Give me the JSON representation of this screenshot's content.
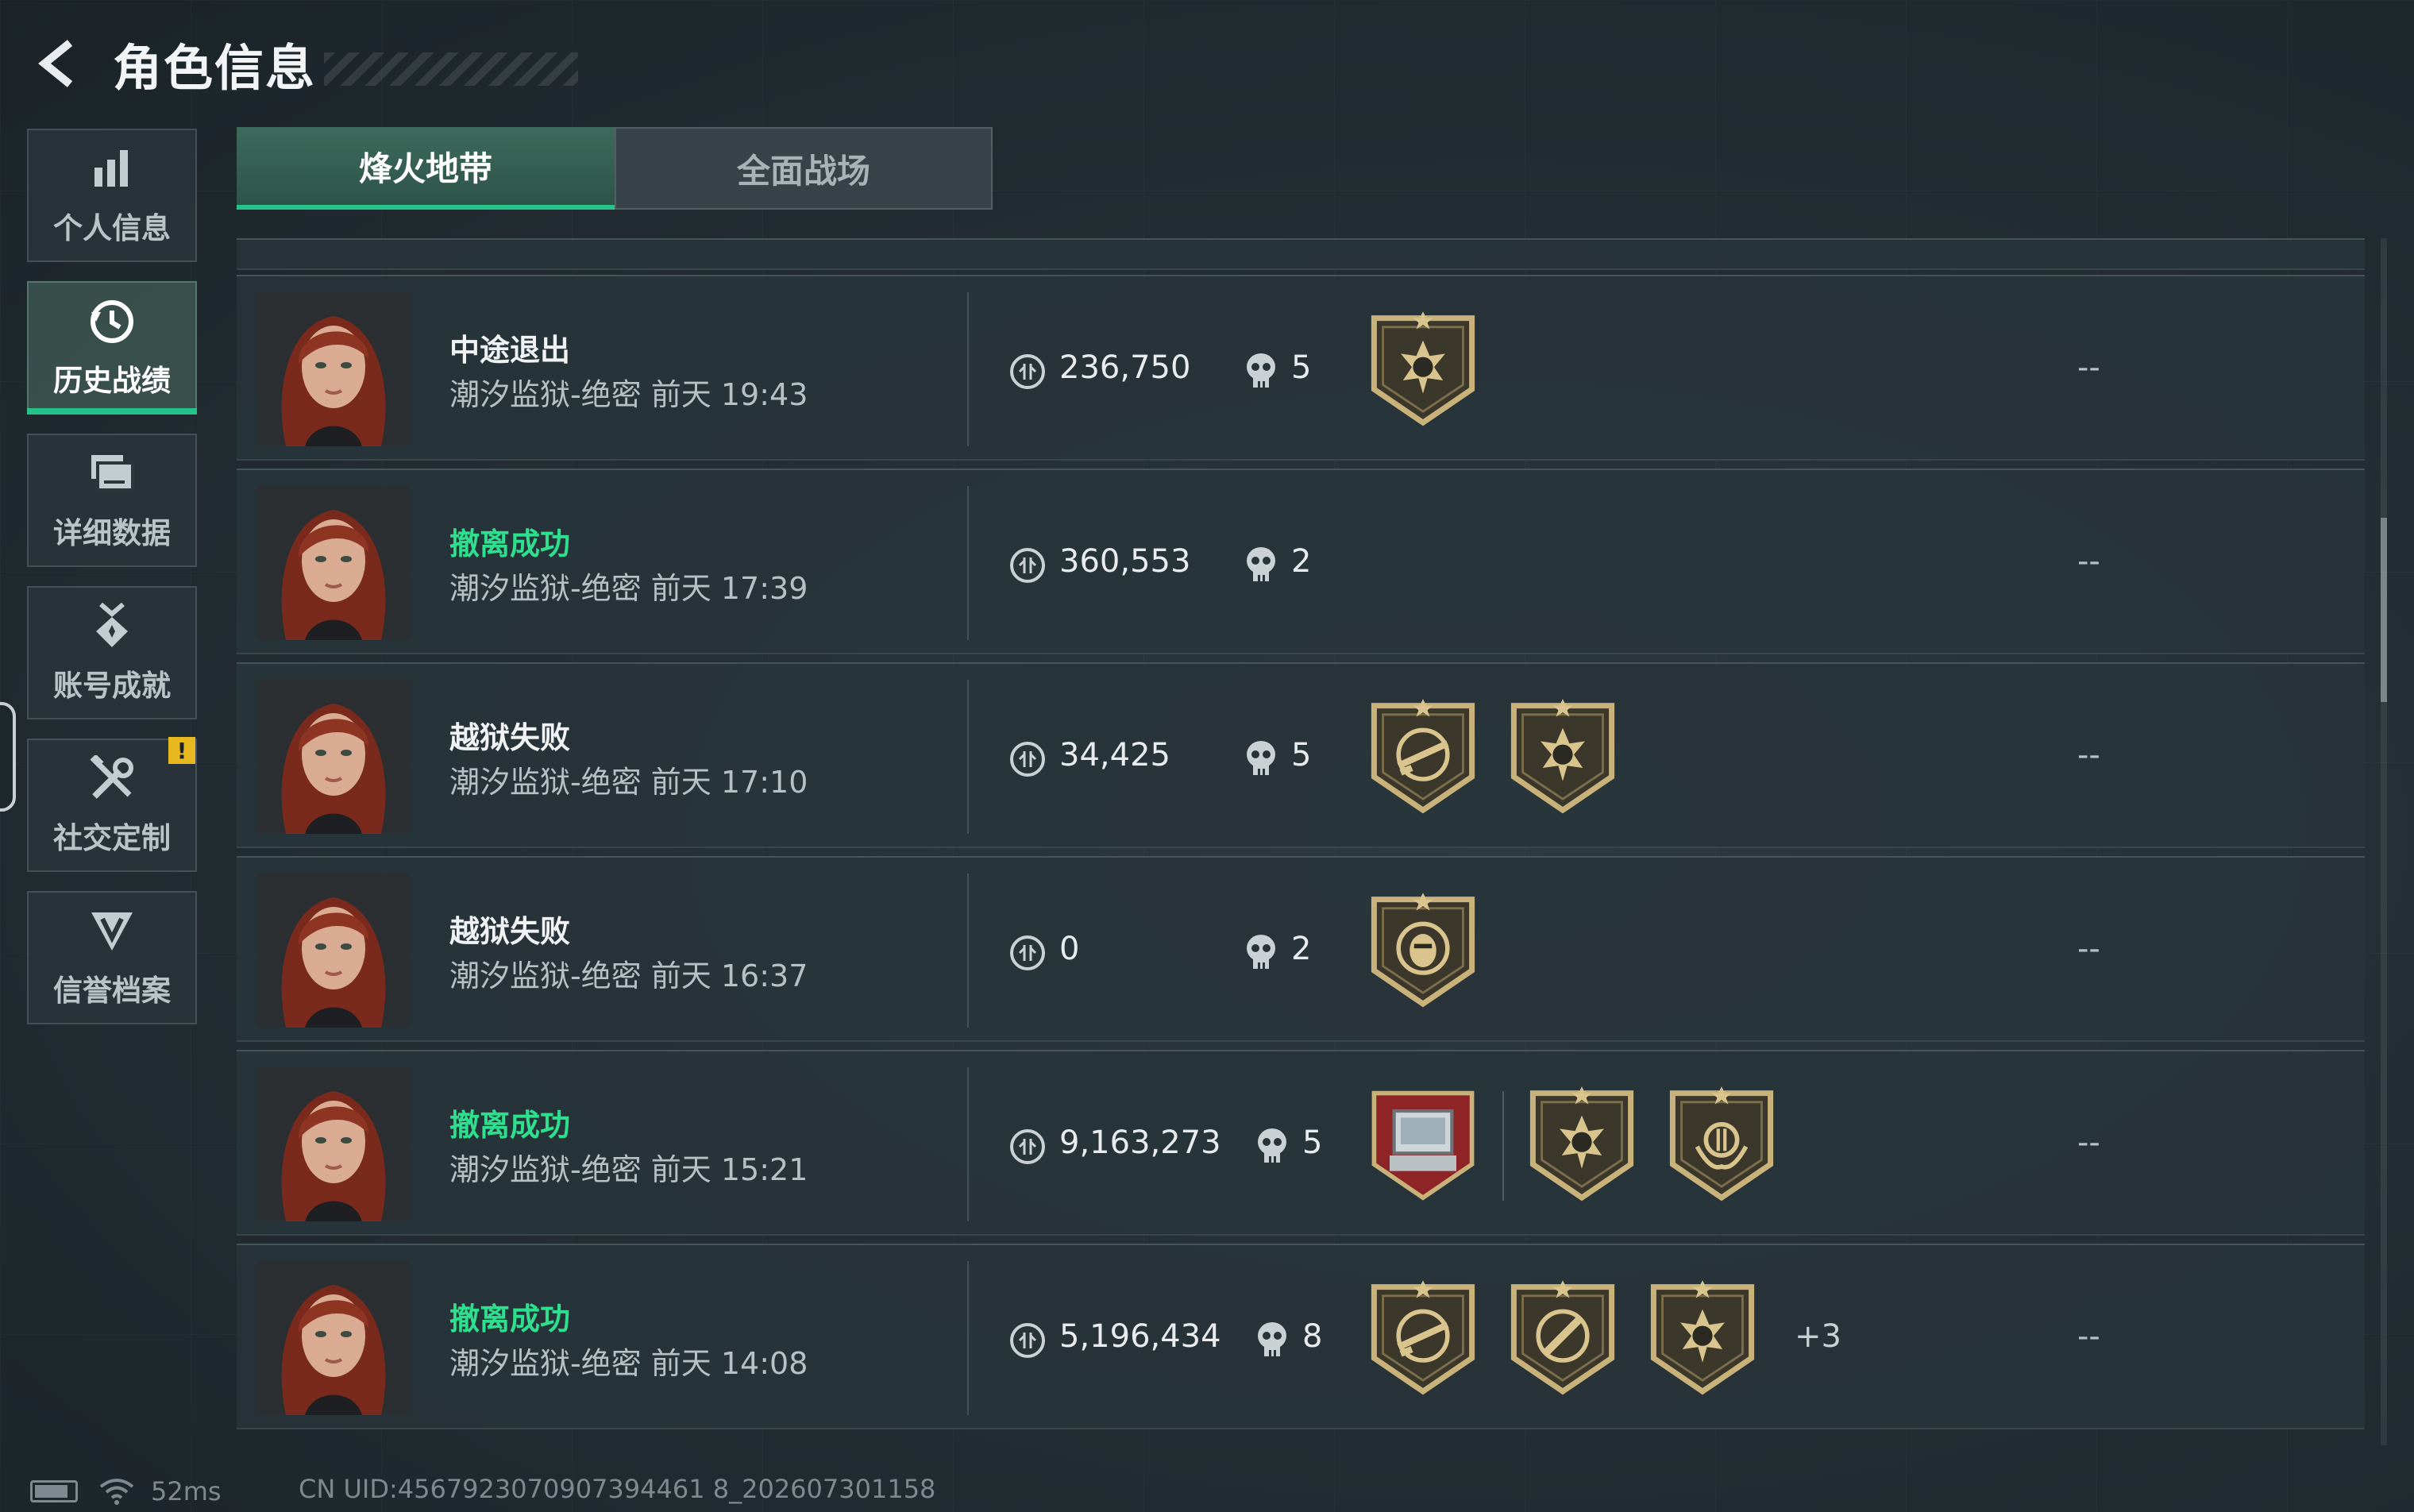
{
  "header": {
    "title": "角色信息"
  },
  "sidebar": {
    "items": [
      {
        "label": "个人信息",
        "icon": "bar-chart-icon",
        "active": false
      },
      {
        "label": "历史战绩",
        "icon": "history-clock-icon",
        "active": true
      },
      {
        "label": "详细数据",
        "icon": "folder-stack-icon",
        "active": false
      },
      {
        "label": "账号成就",
        "icon": "medal-icon",
        "active": false
      },
      {
        "label": "社交定制",
        "icon": "tools-icon",
        "active": false,
        "alert": "!"
      },
      {
        "label": "信誉档案",
        "icon": "shield-emblem-icon",
        "active": false
      }
    ]
  },
  "tabs": [
    {
      "label": "烽火地带",
      "active": true
    },
    {
      "label": "全面战场",
      "active": false
    }
  ],
  "matches": [
    {
      "status": "中途退出",
      "success": false,
      "map": "潮汐监狱-绝密 前天 19:43",
      "money": "236,750",
      "kills": "5",
      "badges": [
        "skull-star-badge"
      ],
      "more": "",
      "extra": "--"
    },
    {
      "status": "撤离成功",
      "success": true,
      "map": "潮汐监狱-绝密 前天 17:39",
      "money": "360,553",
      "kills": "2",
      "badges": [],
      "more": "",
      "extra": "--"
    },
    {
      "status": "越狱失败",
      "success": false,
      "map": "潮汐监狱-绝密 前天 17:10",
      "money": "34,425",
      "kills": "5",
      "badges": [
        "rifle-crosshair-badge",
        "skull-star-badge"
      ],
      "more": "",
      "extra": "--"
    },
    {
      "status": "越狱失败",
      "success": false,
      "map": "潮汐监狱-绝密 前天 16:37",
      "money": "0",
      "kills": "2",
      "badges": [
        "masked-crosshair-badge"
      ],
      "more": "",
      "extra": "--"
    },
    {
      "status": "撤离成功",
      "success": true,
      "map": "潮汐监狱-绝密 前天 15:21",
      "money": "9,163,273",
      "kills": "5",
      "badges": [
        "computer-item-badge",
        "skull-star-badge",
        "laurel-coin-badge"
      ],
      "more": "",
      "extra": "--"
    },
    {
      "status": "撤离成功",
      "success": true,
      "map": "潮汐监狱-绝密 前天 14:08",
      "money": "5,196,434",
      "kills": "8",
      "badges": [
        "rifle-crosshair-badge",
        "knife-crosshair-badge",
        "skull-star-badge"
      ],
      "more": "+3",
      "extra": "--"
    }
  ],
  "statusbar": {
    "ping": "52ms",
    "uid": "CN UID:4567923070907394461 8_202607301158"
  },
  "colors": {
    "accent": "#25c28a",
    "success": "#2ee08e",
    "warning": "#e8b820",
    "badge_gold": "#c9b27a"
  }
}
